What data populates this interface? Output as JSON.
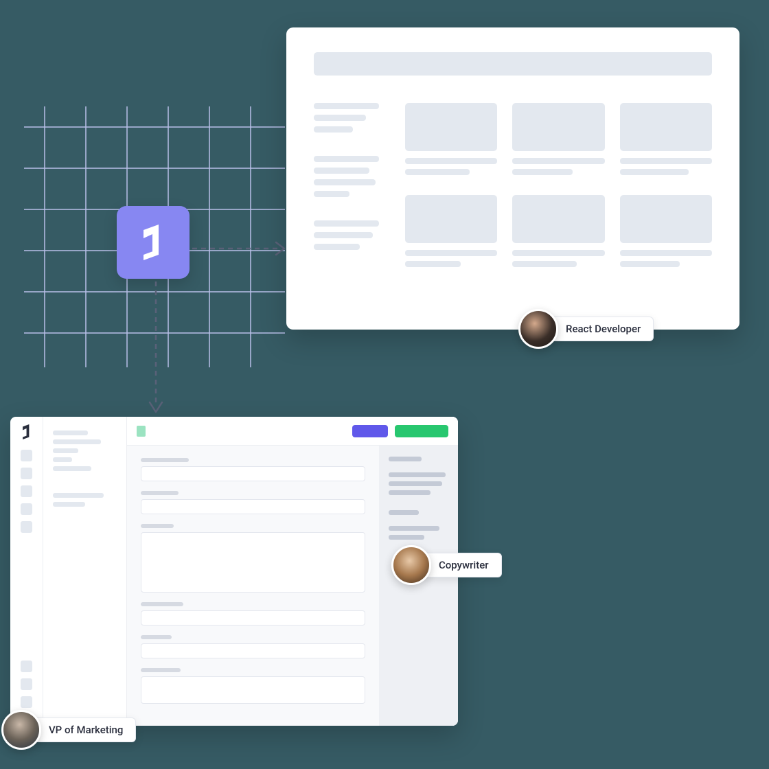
{
  "personas": {
    "react": "React Developer",
    "copy": "Copywriter",
    "vp": "VP of Marketing"
  },
  "icons": {
    "logo": "graphcms-logo",
    "arrow_right": "arrow-right",
    "arrow_down": "arrow-down"
  },
  "colors": {
    "accent": "#8787f2",
    "primary_button": "#6058ea",
    "success_button": "#28c76f"
  }
}
